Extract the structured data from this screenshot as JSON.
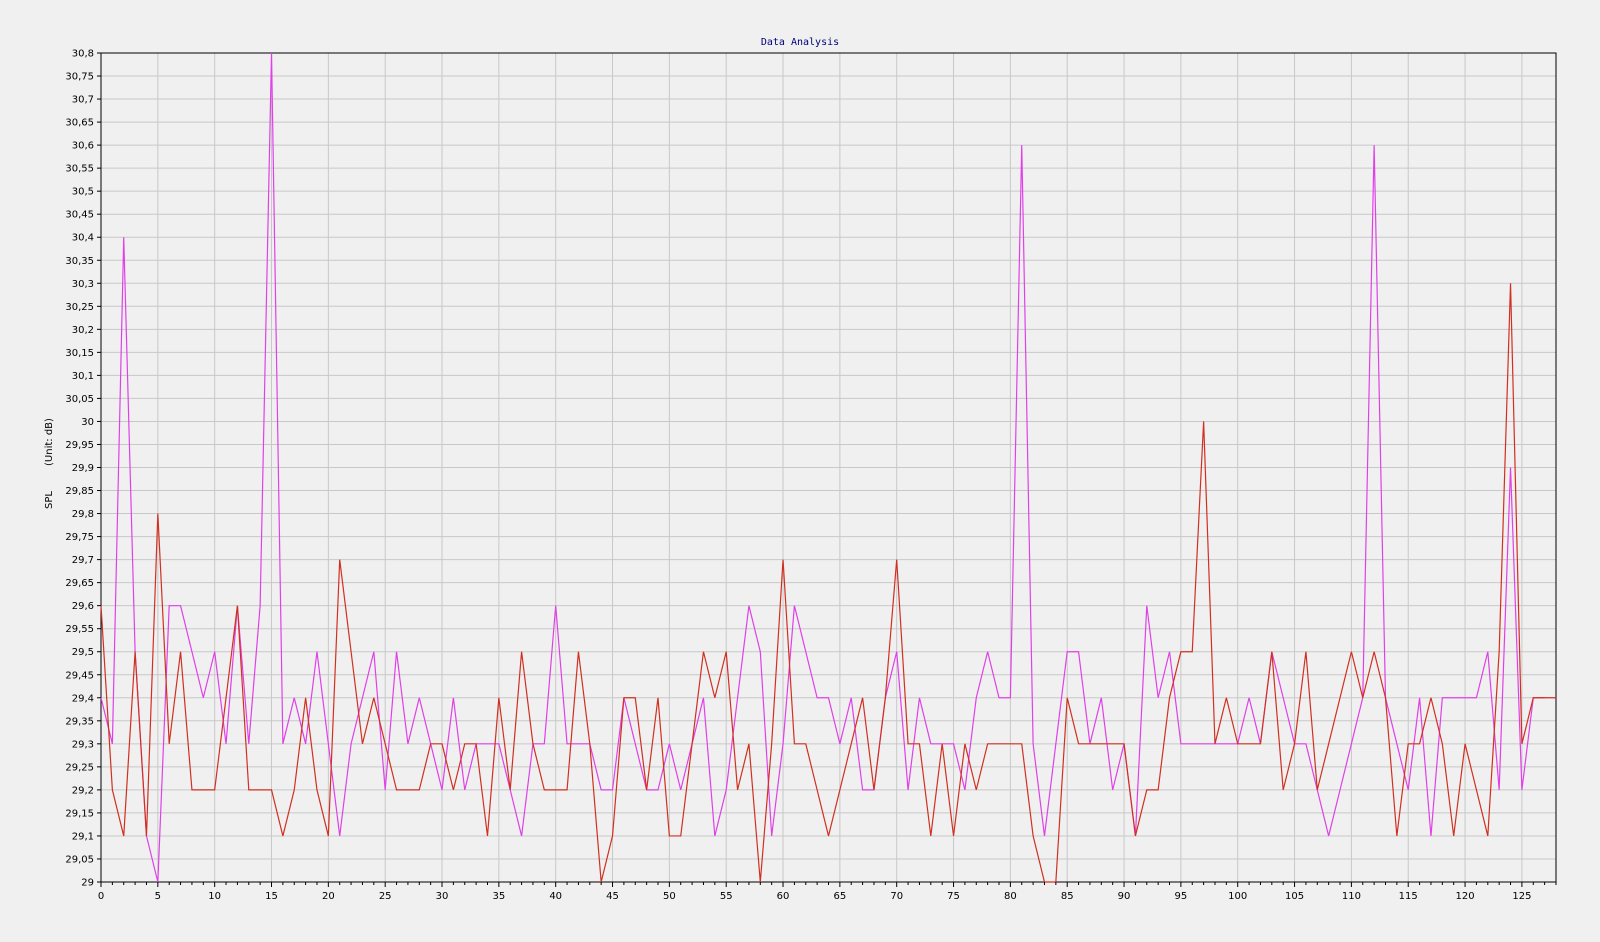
{
  "chart_data": {
    "type": "line",
    "title": "Data Analysis",
    "ylabel": "SPL",
    "ylabel_unit": "(Unit: dB)",
    "xlabel": "",
    "xlim": [
      0,
      128
    ],
    "ylim": [
      29,
      30.8
    ],
    "x_ticks": [
      0,
      5,
      10,
      15,
      20,
      25,
      30,
      35,
      40,
      45,
      50,
      55,
      60,
      65,
      70,
      75,
      80,
      85,
      90,
      95,
      100,
      105,
      110,
      115,
      120,
      125
    ],
    "y_ticks": [
      "29",
      "29,05",
      "29,1",
      "29,15",
      "29,2",
      "29,25",
      "29,3",
      "29,35",
      "29,4",
      "29,45",
      "29,5",
      "29,55",
      "29,6",
      "29,65",
      "29,7",
      "29,75",
      "29,8",
      "29,85",
      "29,9",
      "29,95",
      "30",
      "30,05",
      "30,1",
      "30,15",
      "30,2",
      "30,25",
      "30,3",
      "30,35",
      "30,4",
      "30,45",
      "30,5",
      "30,55",
      "30,6",
      "30,65",
      "30,7",
      "30,75",
      "30,8"
    ],
    "grid": true,
    "legend": "none",
    "series": [
      {
        "color": "#e040e8",
        "values": [
          29.4,
          29.3,
          30.4,
          29.5,
          29.1,
          29.0,
          29.6,
          29.6,
          29.5,
          29.4,
          29.5,
          29.3,
          29.6,
          29.3,
          29.6,
          30.8,
          29.3,
          29.4,
          29.3,
          29.5,
          29.3,
          29.1,
          29.3,
          29.4,
          29.5,
          29.2,
          29.5,
          29.3,
          29.4,
          29.3,
          29.2,
          29.4,
          29.2,
          29.3,
          29.3,
          29.3,
          29.2,
          29.1,
          29.3,
          29.3,
          29.6,
          29.3,
          29.3,
          29.3,
          29.2,
          29.2,
          29.4,
          29.3,
          29.2,
          29.2,
          29.3,
          29.2,
          29.3,
          29.4,
          29.1,
          29.2,
          29.4,
          29.6,
          29.5,
          29.1,
          29.3,
          29.6,
          29.5,
          29.4,
          29.4,
          29.3,
          29.4,
          29.2,
          29.2,
          29.4,
          29.5,
          29.2,
          29.4,
          29.3,
          29.3,
          29.3,
          29.2,
          29.4,
          29.5,
          29.4,
          29.4,
          30.6,
          29.3,
          29.1,
          29.3,
          29.5,
          29.5,
          29.3,
          29.4,
          29.2,
          29.3,
          29.1,
          29.6,
          29.4,
          29.5,
          29.3,
          29.3,
          29.3,
          29.3,
          29.3,
          29.3,
          29.4,
          29.3,
          29.5,
          29.4,
          29.3,
          29.3,
          29.2,
          29.1,
          29.2,
          29.3,
          29.4,
          30.6,
          29.4,
          29.3,
          29.2,
          29.4,
          29.1,
          29.4,
          29.4,
          29.4,
          29.4,
          29.5,
          29.2,
          29.9,
          29.2,
          29.4,
          29.4
        ]
      },
      {
        "color": "#d03020",
        "values": [
          29.6,
          29.2,
          29.1,
          29.5,
          29.1,
          29.8,
          29.3,
          29.5,
          29.2,
          29.2,
          29.2,
          29.4,
          29.6,
          29.2,
          29.2,
          29.2,
          29.1,
          29.2,
          29.4,
          29.2,
          29.1,
          29.7,
          29.5,
          29.3,
          29.4,
          29.3,
          29.2,
          29.2,
          29.2,
          29.3,
          29.3,
          29.2,
          29.3,
          29.3,
          29.1,
          29.4,
          29.2,
          29.5,
          29.3,
          29.2,
          29.2,
          29.2,
          29.5,
          29.3,
          29.0,
          29.1,
          29.4,
          29.4,
          29.2,
          29.4,
          29.1,
          29.1,
          29.3,
          29.5,
          29.4,
          29.5,
          29.2,
          29.3,
          29.0,
          29.3,
          29.7,
          29.3,
          29.3,
          29.2,
          29.1,
          29.2,
          29.3,
          29.4,
          29.2,
          29.4,
          29.7,
          29.3,
          29.3,
          29.1,
          29.3,
          29.1,
          29.3,
          29.2,
          29.3,
          29.3,
          29.3,
          29.3,
          29.1,
          29.0,
          29.0,
          29.4,
          29.3,
          29.3,
          29.3,
          29.3,
          29.3,
          29.1,
          29.2,
          29.2,
          29.4,
          29.5,
          29.5,
          30.0,
          29.3,
          29.4,
          29.3,
          29.3,
          29.3,
          29.5,
          29.2,
          29.3,
          29.5,
          29.2,
          29.3,
          29.4,
          29.5,
          29.4,
          29.5,
          29.4,
          29.1,
          29.3,
          29.3,
          29.4,
          29.3,
          29.1,
          29.3,
          29.2,
          29.1,
          29.5,
          30.3,
          29.3,
          29.4,
          29.4,
          29.4
        ]
      }
    ]
  },
  "colors": {
    "background": "#f0f0f0",
    "grid": "#c8c8c8",
    "axis": "#000000",
    "title": "#00007a"
  }
}
